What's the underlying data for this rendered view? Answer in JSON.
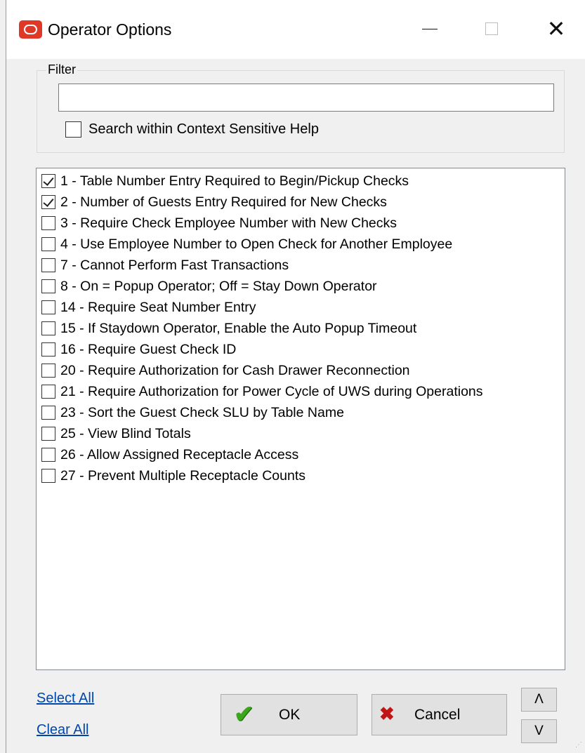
{
  "window": {
    "title": "Operator Options",
    "icon": "oracle-logo-icon",
    "controls": {
      "minimize": "—",
      "maximize": "□",
      "close": "✕"
    }
  },
  "filter": {
    "legend": "Filter",
    "value": "",
    "placeholder": "",
    "search_help_label": "Search within Context Sensitive Help",
    "search_help_checked": false
  },
  "options": [
    {
      "label": "1 - Table Number Entry Required to Begin/Pickup Checks",
      "checked": true
    },
    {
      "label": "2 - Number of Guests Entry Required for New Checks",
      "checked": true
    },
    {
      "label": "3 - Require Check Employee Number with New Checks",
      "checked": false
    },
    {
      "label": "4 - Use Employee Number to Open Check for Another Employee",
      "checked": false
    },
    {
      "label": "7 - Cannot Perform Fast Transactions",
      "checked": false
    },
    {
      "label": "8 - On = Popup Operator; Off = Stay Down Operator",
      "checked": false
    },
    {
      "label": "14 - Require Seat Number Entry",
      "checked": false
    },
    {
      "label": "15 - If Staydown Operator, Enable the Auto Popup Timeout",
      "checked": false
    },
    {
      "label": "16 - Require Guest Check ID",
      "checked": false
    },
    {
      "label": "20 - Require Authorization for Cash Drawer Reconnection",
      "checked": false
    },
    {
      "label": "21 - Require Authorization for Power Cycle of UWS during Operations",
      "checked": false
    },
    {
      "label": "23 - Sort the Guest Check SLU by Table Name",
      "checked": false
    },
    {
      "label": "25 - View Blind Totals",
      "checked": false
    },
    {
      "label": "26 - Allow Assigned Receptacle Access",
      "checked": false
    },
    {
      "label": "27 - Prevent Multiple Receptacle Counts",
      "checked": false
    }
  ],
  "links": {
    "select_all": "Select All",
    "clear_all": "Clear All"
  },
  "buttons": {
    "ok": "OK",
    "ok_icon": "checkmark-icon",
    "cancel": "Cancel",
    "cancel_icon": "x-icon",
    "up": "Λ",
    "down": "V"
  },
  "colors": {
    "accent_link": "#0047ab",
    "ok_icon": "#3aa619",
    "cancel_icon": "#c01515",
    "app_icon": "#e03826"
  }
}
